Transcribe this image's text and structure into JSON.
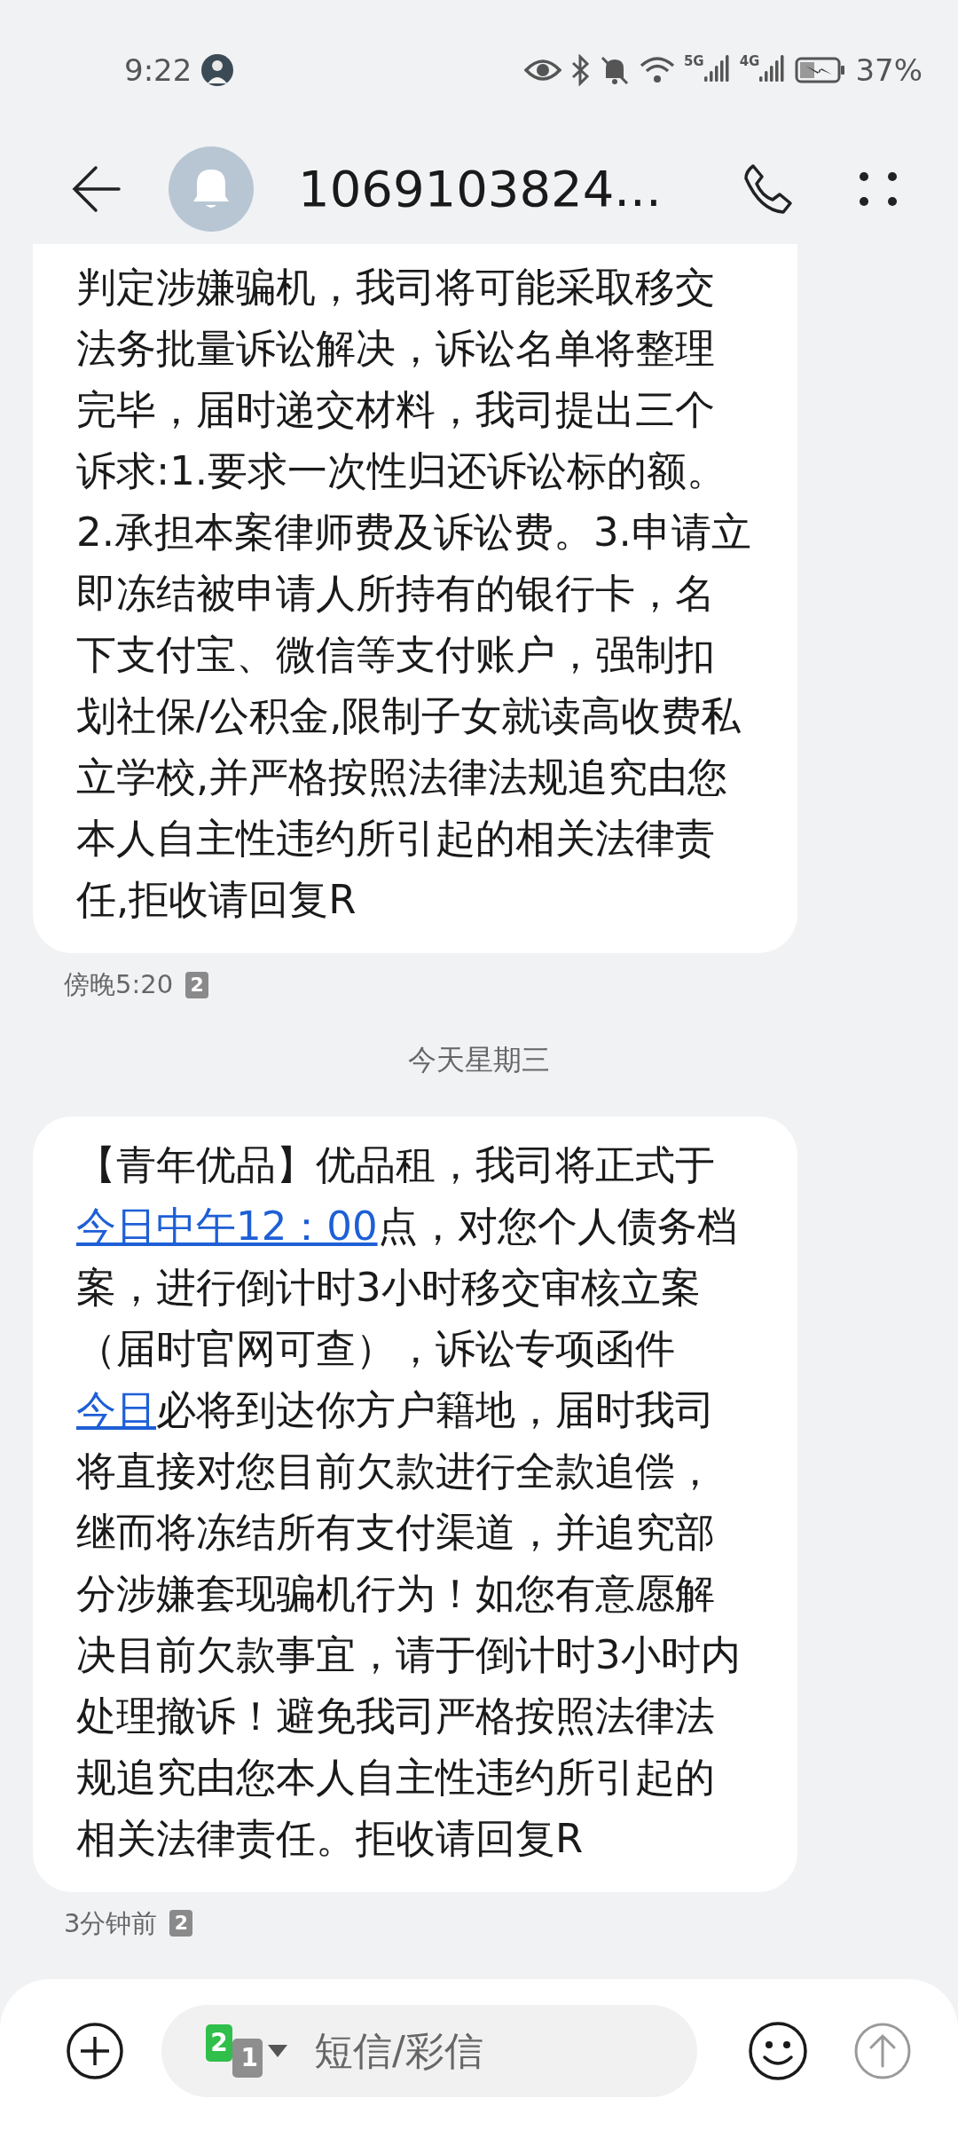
{
  "status_bar": {
    "time": "9:22",
    "network_1": "5G",
    "network_2": "4G",
    "battery": "37%"
  },
  "header": {
    "title": "1069103824..."
  },
  "messages": [
    {
      "segments": [
        {
          "kind": "text",
          "text": "判定涉嫌骗机，我司将可能采取移交法务批量诉讼解决，诉讼名单将整理完毕，届时递交材料，我司提出三个诉求:1.要求一次性归还诉讼标的额。2.承担本案律师费及诉讼费。3.申请立即冻结被申请人所持有的银行卡，名下支付宝、微信等支付账户，强制扣划社保/公积金,限制子女就读高收费私立学校,并严格按照法律法规追究由您本人自主性违约所引起的相关法律责任,拒收请回复R"
        }
      ],
      "time": "傍晚5:20",
      "sim": "2",
      "cut_top": true
    },
    {
      "date_divider": "今天星期三",
      "segments": [
        {
          "kind": "text",
          "text": "【青年优品】优品租，我司将正式于"
        },
        {
          "kind": "link",
          "text": "今日中午12：00"
        },
        {
          "kind": "text",
          "text": "点，对您个人债务档案，进行倒计时3小时移交审核立案（届时官网可查），诉讼专项函件"
        },
        {
          "kind": "link",
          "text": "今日"
        },
        {
          "kind": "text",
          "text": "必将到达你方户籍地，届时我司将直接对您目前欠款进行全款追偿，继而将冻结所有支付渠道，并追究部分涉嫌套现骗机行为！如您有意愿解决目前欠款事宜，请于倒计时3小时内处理撤诉！避免我司严格按照法律法规追究由您本人自主性违约所引起的相关法律责任。拒收请回复R"
        }
      ],
      "time": "3分钟前",
      "sim": "2",
      "cut_top": false
    }
  ],
  "composer": {
    "sim_primary": "2",
    "sim_secondary": "1",
    "placeholder": "短信/彩信"
  }
}
